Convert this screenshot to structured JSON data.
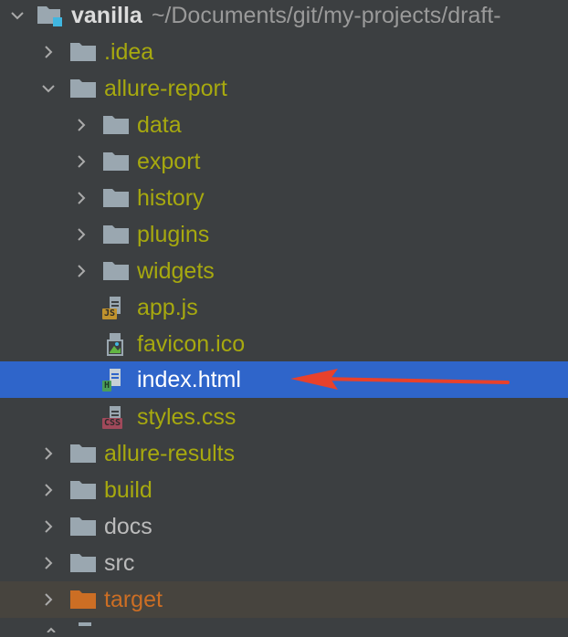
{
  "project": {
    "name": "vanilla",
    "path": "~/Documents/git/my-projects/draft-"
  },
  "tree": [
    {
      "label": ".idea",
      "type": "folder",
      "expanded": false
    },
    {
      "label": "allure-report",
      "type": "folder",
      "expanded": true
    },
    {
      "label": "data",
      "type": "folder",
      "expanded": false
    },
    {
      "label": "export",
      "type": "folder",
      "expanded": false
    },
    {
      "label": "history",
      "type": "folder",
      "expanded": false
    },
    {
      "label": "plugins",
      "type": "folder",
      "expanded": false
    },
    {
      "label": "widgets",
      "type": "folder",
      "expanded": false
    },
    {
      "label": "app.js",
      "type": "file",
      "badge": "JS"
    },
    {
      "label": "favicon.ico",
      "type": "file",
      "badge": "image"
    },
    {
      "label": "index.html",
      "type": "file",
      "badge": "H",
      "selected": true
    },
    {
      "label": "styles.css",
      "type": "file",
      "badge": "CSS"
    },
    {
      "label": "allure-results",
      "type": "folder",
      "expanded": false
    },
    {
      "label": "build",
      "type": "folder",
      "expanded": false
    },
    {
      "label": "docs",
      "type": "folder",
      "expanded": false
    },
    {
      "label": "src",
      "type": "folder",
      "expanded": false
    },
    {
      "label": "target",
      "type": "folder",
      "expanded": false,
      "excluded": true
    }
  ],
  "colors": {
    "background": "#3c3f41",
    "selection": "#2f65ca",
    "folder_text": "#a7a90f",
    "plain_text": "#bbbbbb",
    "excluded_text": "#cc6e24",
    "annotation_arrow": "#e8412b"
  }
}
